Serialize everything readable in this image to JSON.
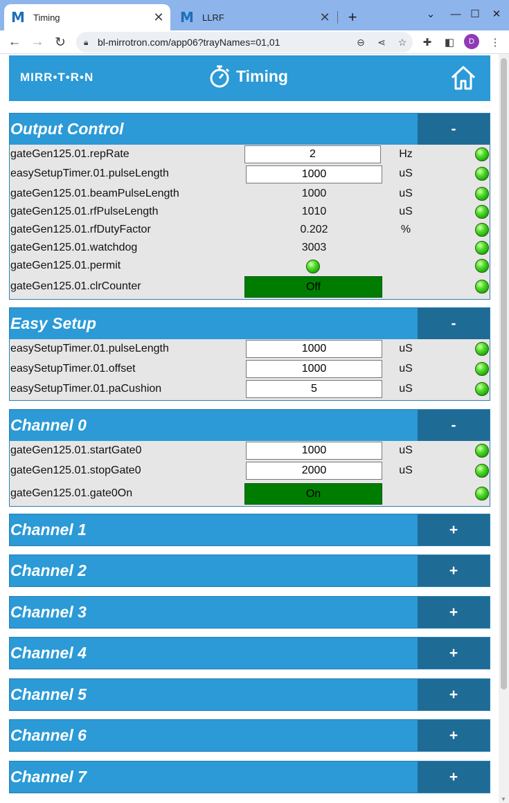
{
  "browser": {
    "tabs": [
      {
        "favicon": "M",
        "title": "Timing"
      },
      {
        "favicon": "M",
        "title": "LLRF"
      }
    ],
    "new_tab": "+",
    "url": "bl-mirrotron.com/app06?trayNames=01,01",
    "profile_initial": "D",
    "win_controls": [
      "⌄",
      "—",
      "☐",
      "✕"
    ]
  },
  "app": {
    "logo": "MIRR•T•R•N",
    "title": "Timing"
  },
  "sections": {
    "output_control": {
      "title": "Output Control",
      "toggle": "-",
      "rows": [
        {
          "label": "gateGen125.01.repRate",
          "value": "2",
          "unit": "Hz"
        },
        {
          "label": "easySetupTimer.01.pulseLength",
          "value": "1000",
          "unit": "uS"
        },
        {
          "label": "gateGen125.01.beamPulseLength",
          "value": "1000",
          "unit": "uS"
        },
        {
          "label": "gateGen125.01.rfPulseLength",
          "value": "1010",
          "unit": "uS"
        },
        {
          "label": "gateGen125.01.rfDutyFactor",
          "value": "0.202",
          "unit": "%"
        },
        {
          "label": "gateGen125.01.watchdog",
          "value": "3003",
          "unit": ""
        },
        {
          "label": "gateGen125.01.permit",
          "value": "",
          "unit": ""
        },
        {
          "label": "gateGen125.01.clrCounter",
          "value": "Off",
          "unit": ""
        }
      ]
    },
    "easy_setup": {
      "title": "Easy Setup",
      "toggle": "-",
      "rows": [
        {
          "label": "easySetupTimer.01.pulseLength",
          "value": "1000",
          "unit": "uS"
        },
        {
          "label": "easySetupTimer.01.offset",
          "value": "1000",
          "unit": "uS"
        },
        {
          "label": "easySetupTimer.01.paCushion",
          "value": "5",
          "unit": "uS"
        }
      ]
    },
    "channel_0": {
      "title": "Channel 0",
      "toggle": "-",
      "rows": [
        {
          "label": "gateGen125.01.startGate0",
          "value": "1000",
          "unit": "uS"
        },
        {
          "label": "gateGen125.01.stopGate0",
          "value": "2000",
          "unit": "uS"
        },
        {
          "label": "gateGen125.01.gate0On",
          "value": "On",
          "unit": ""
        }
      ]
    },
    "collapsed": [
      {
        "title": "Channel 1",
        "toggle": "+"
      },
      {
        "title": "Channel 2",
        "toggle": "+"
      },
      {
        "title": "Channel 3",
        "toggle": "+"
      },
      {
        "title": "Channel 4",
        "toggle": "+"
      },
      {
        "title": "Channel 5",
        "toggle": "+"
      },
      {
        "title": "Channel 6",
        "toggle": "+"
      },
      {
        "title": "Channel 7",
        "toggle": "+"
      }
    ]
  },
  "colors": {
    "accent": "#2b9ad6",
    "toggle_bg": "#1e6b96",
    "button_green": "#007d00",
    "led_green": "#52e028"
  }
}
